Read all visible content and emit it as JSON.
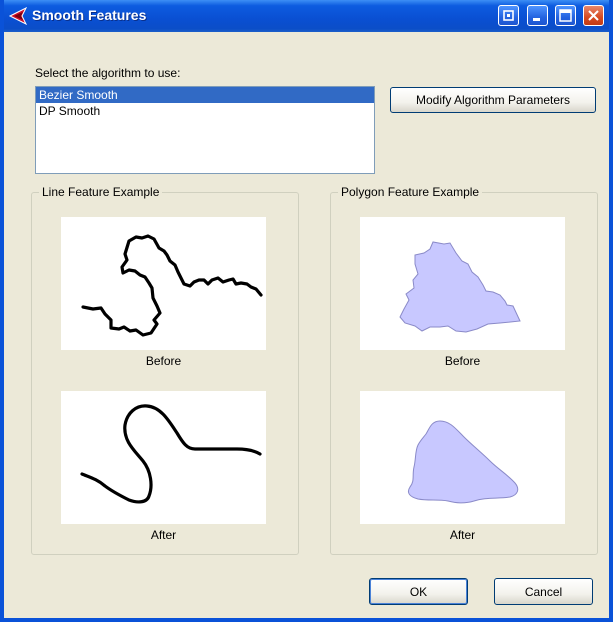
{
  "window": {
    "title": "Smooth Features"
  },
  "titlebar_buttons": [
    {
      "name": "restore-icon"
    },
    {
      "name": "minimize-icon"
    },
    {
      "name": "maximize-icon"
    },
    {
      "name": "close-icon"
    }
  ],
  "algorithm": {
    "label": "Select the algorithm to use:",
    "items": [
      "Bezier Smooth",
      "DP Smooth"
    ],
    "selected": "Bezier Smooth",
    "modify_button": "Modify Algorithm Parameters"
  },
  "line_example": {
    "title": "Line Feature Example",
    "before_caption": "Before",
    "after_caption": "After"
  },
  "polygon_example": {
    "title": "Polygon Feature Example",
    "before_caption": "Before",
    "after_caption": "After"
  },
  "buttons": {
    "ok": "OK",
    "cancel": "Cancel"
  },
  "colors": {
    "titlebar": "#0a4fd2",
    "selection": "#316ac5",
    "polygon_fill": "#c8c8ff",
    "polygon_stroke": "#8a8ac8"
  }
}
